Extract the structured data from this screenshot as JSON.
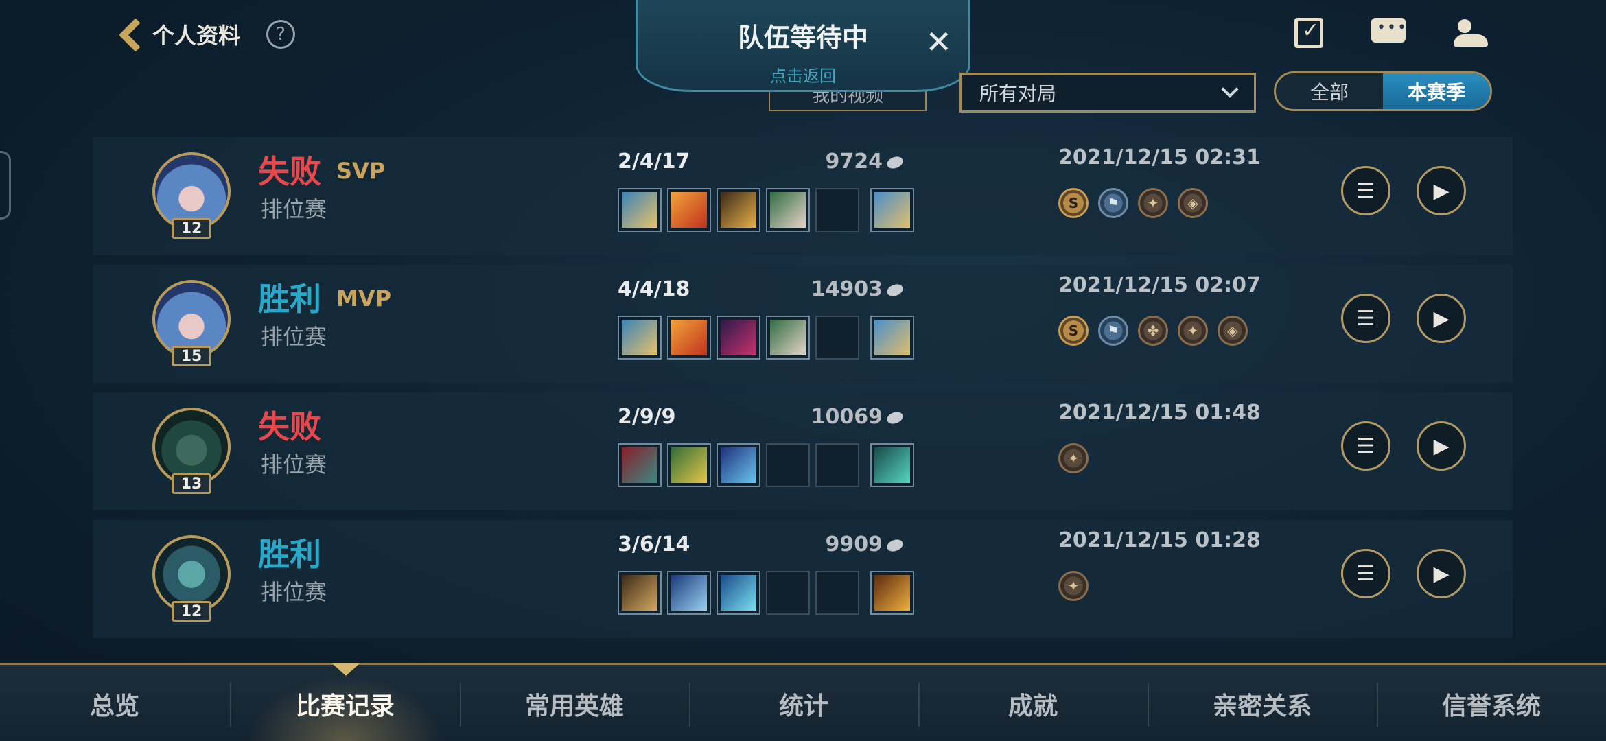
{
  "header": {
    "back_label": "个人资料",
    "help_label": "?",
    "team_wait_title": "队伍等待中",
    "team_wait_sub": "点击返回",
    "video_button": "我的视频",
    "filter_value": "所有对局",
    "toggle_all": "全部",
    "toggle_season": "本赛季",
    "icons": [
      "clipboard-check-icon",
      "chat-icon",
      "friends-icon"
    ]
  },
  "matches": [
    {
      "result": "失败",
      "badge": "SVP",
      "mode": "排位赛",
      "level": "12",
      "kda": "2/4/17",
      "gold": "9724",
      "date": "2021/12/15 02:31"
    },
    {
      "result": "胜利",
      "badge": "MVP",
      "mode": "排位赛",
      "level": "15",
      "kda": "4/4/18",
      "gold": "14903",
      "date": "2021/12/15 02:07"
    },
    {
      "result": "失败",
      "badge": "",
      "mode": "排位赛",
      "level": "13",
      "kda": "2/9/9",
      "gold": "10069",
      "date": "2021/12/15 01:48"
    },
    {
      "result": "胜利",
      "badge": "",
      "mode": "排位赛",
      "level": "12",
      "kda": "3/6/14",
      "gold": "9909",
      "date": "2021/12/15 01:28"
    }
  ],
  "nav": [
    "总览",
    "比赛记录",
    "常用英雄",
    "统计",
    "成就",
    "亲密关系",
    "信誉系统"
  ],
  "colors": {
    "lose": "#e8484c",
    "win": "#29a9c9",
    "accent_gold": "#b89a5a",
    "active_toggle": "#2a8ec0"
  }
}
